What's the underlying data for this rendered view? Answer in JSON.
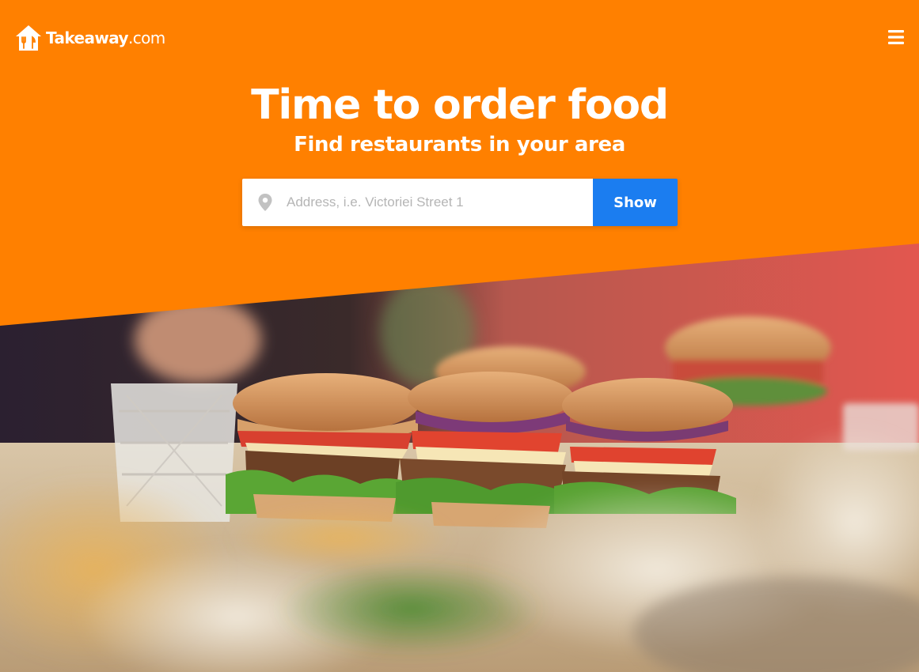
{
  "header": {
    "logo_text": "Takeaway",
    "logo_suffix": ".com",
    "menu_icon": "hamburger-menu-icon"
  },
  "hero": {
    "title": "Time to order food",
    "subtitle": "Find restaurants in your area"
  },
  "search": {
    "placeholder": "Address, i.e. Victoriei Street 1",
    "value": "",
    "button_label": "Show",
    "location_icon": "map-pin-icon"
  },
  "colors": {
    "brand_orange": "#ff8000",
    "button_blue": "#1b7df0",
    "text_white": "#ffffff",
    "placeholder_gray": "#b5b5b5"
  }
}
